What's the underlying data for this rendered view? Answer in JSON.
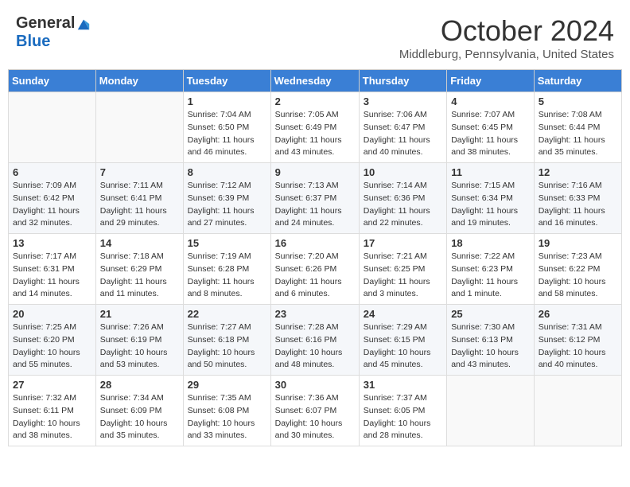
{
  "header": {
    "logo_general": "General",
    "logo_blue": "Blue",
    "month_title": "October 2024",
    "location": "Middleburg, Pennsylvania, United States"
  },
  "weekdays": [
    "Sunday",
    "Monday",
    "Tuesday",
    "Wednesday",
    "Thursday",
    "Friday",
    "Saturday"
  ],
  "weeks": [
    [
      {
        "day": "",
        "sunrise": "",
        "sunset": "",
        "daylight": ""
      },
      {
        "day": "",
        "sunrise": "",
        "sunset": "",
        "daylight": ""
      },
      {
        "day": "1",
        "sunrise": "Sunrise: 7:04 AM",
        "sunset": "Sunset: 6:50 PM",
        "daylight": "Daylight: 11 hours and 46 minutes."
      },
      {
        "day": "2",
        "sunrise": "Sunrise: 7:05 AM",
        "sunset": "Sunset: 6:49 PM",
        "daylight": "Daylight: 11 hours and 43 minutes."
      },
      {
        "day": "3",
        "sunrise": "Sunrise: 7:06 AM",
        "sunset": "Sunset: 6:47 PM",
        "daylight": "Daylight: 11 hours and 40 minutes."
      },
      {
        "day": "4",
        "sunrise": "Sunrise: 7:07 AM",
        "sunset": "Sunset: 6:45 PM",
        "daylight": "Daylight: 11 hours and 38 minutes."
      },
      {
        "day": "5",
        "sunrise": "Sunrise: 7:08 AM",
        "sunset": "Sunset: 6:44 PM",
        "daylight": "Daylight: 11 hours and 35 minutes."
      }
    ],
    [
      {
        "day": "6",
        "sunrise": "Sunrise: 7:09 AM",
        "sunset": "Sunset: 6:42 PM",
        "daylight": "Daylight: 11 hours and 32 minutes."
      },
      {
        "day": "7",
        "sunrise": "Sunrise: 7:11 AM",
        "sunset": "Sunset: 6:41 PM",
        "daylight": "Daylight: 11 hours and 29 minutes."
      },
      {
        "day": "8",
        "sunrise": "Sunrise: 7:12 AM",
        "sunset": "Sunset: 6:39 PM",
        "daylight": "Daylight: 11 hours and 27 minutes."
      },
      {
        "day": "9",
        "sunrise": "Sunrise: 7:13 AM",
        "sunset": "Sunset: 6:37 PM",
        "daylight": "Daylight: 11 hours and 24 minutes."
      },
      {
        "day": "10",
        "sunrise": "Sunrise: 7:14 AM",
        "sunset": "Sunset: 6:36 PM",
        "daylight": "Daylight: 11 hours and 22 minutes."
      },
      {
        "day": "11",
        "sunrise": "Sunrise: 7:15 AM",
        "sunset": "Sunset: 6:34 PM",
        "daylight": "Daylight: 11 hours and 19 minutes."
      },
      {
        "day": "12",
        "sunrise": "Sunrise: 7:16 AM",
        "sunset": "Sunset: 6:33 PM",
        "daylight": "Daylight: 11 hours and 16 minutes."
      }
    ],
    [
      {
        "day": "13",
        "sunrise": "Sunrise: 7:17 AM",
        "sunset": "Sunset: 6:31 PM",
        "daylight": "Daylight: 11 hours and 14 minutes."
      },
      {
        "day": "14",
        "sunrise": "Sunrise: 7:18 AM",
        "sunset": "Sunset: 6:29 PM",
        "daylight": "Daylight: 11 hours and 11 minutes."
      },
      {
        "day": "15",
        "sunrise": "Sunrise: 7:19 AM",
        "sunset": "Sunset: 6:28 PM",
        "daylight": "Daylight: 11 hours and 8 minutes."
      },
      {
        "day": "16",
        "sunrise": "Sunrise: 7:20 AM",
        "sunset": "Sunset: 6:26 PM",
        "daylight": "Daylight: 11 hours and 6 minutes."
      },
      {
        "day": "17",
        "sunrise": "Sunrise: 7:21 AM",
        "sunset": "Sunset: 6:25 PM",
        "daylight": "Daylight: 11 hours and 3 minutes."
      },
      {
        "day": "18",
        "sunrise": "Sunrise: 7:22 AM",
        "sunset": "Sunset: 6:23 PM",
        "daylight": "Daylight: 11 hours and 1 minute."
      },
      {
        "day": "19",
        "sunrise": "Sunrise: 7:23 AM",
        "sunset": "Sunset: 6:22 PM",
        "daylight": "Daylight: 10 hours and 58 minutes."
      }
    ],
    [
      {
        "day": "20",
        "sunrise": "Sunrise: 7:25 AM",
        "sunset": "Sunset: 6:20 PM",
        "daylight": "Daylight: 10 hours and 55 minutes."
      },
      {
        "day": "21",
        "sunrise": "Sunrise: 7:26 AM",
        "sunset": "Sunset: 6:19 PM",
        "daylight": "Daylight: 10 hours and 53 minutes."
      },
      {
        "day": "22",
        "sunrise": "Sunrise: 7:27 AM",
        "sunset": "Sunset: 6:18 PM",
        "daylight": "Daylight: 10 hours and 50 minutes."
      },
      {
        "day": "23",
        "sunrise": "Sunrise: 7:28 AM",
        "sunset": "Sunset: 6:16 PM",
        "daylight": "Daylight: 10 hours and 48 minutes."
      },
      {
        "day": "24",
        "sunrise": "Sunrise: 7:29 AM",
        "sunset": "Sunset: 6:15 PM",
        "daylight": "Daylight: 10 hours and 45 minutes."
      },
      {
        "day": "25",
        "sunrise": "Sunrise: 7:30 AM",
        "sunset": "Sunset: 6:13 PM",
        "daylight": "Daylight: 10 hours and 43 minutes."
      },
      {
        "day": "26",
        "sunrise": "Sunrise: 7:31 AM",
        "sunset": "Sunset: 6:12 PM",
        "daylight": "Daylight: 10 hours and 40 minutes."
      }
    ],
    [
      {
        "day": "27",
        "sunrise": "Sunrise: 7:32 AM",
        "sunset": "Sunset: 6:11 PM",
        "daylight": "Daylight: 10 hours and 38 minutes."
      },
      {
        "day": "28",
        "sunrise": "Sunrise: 7:34 AM",
        "sunset": "Sunset: 6:09 PM",
        "daylight": "Daylight: 10 hours and 35 minutes."
      },
      {
        "day": "29",
        "sunrise": "Sunrise: 7:35 AM",
        "sunset": "Sunset: 6:08 PM",
        "daylight": "Daylight: 10 hours and 33 minutes."
      },
      {
        "day": "30",
        "sunrise": "Sunrise: 7:36 AM",
        "sunset": "Sunset: 6:07 PM",
        "daylight": "Daylight: 10 hours and 30 minutes."
      },
      {
        "day": "31",
        "sunrise": "Sunrise: 7:37 AM",
        "sunset": "Sunset: 6:05 PM",
        "daylight": "Daylight: 10 hours and 28 minutes."
      },
      {
        "day": "",
        "sunrise": "",
        "sunset": "",
        "daylight": ""
      },
      {
        "day": "",
        "sunrise": "",
        "sunset": "",
        "daylight": ""
      }
    ]
  ]
}
